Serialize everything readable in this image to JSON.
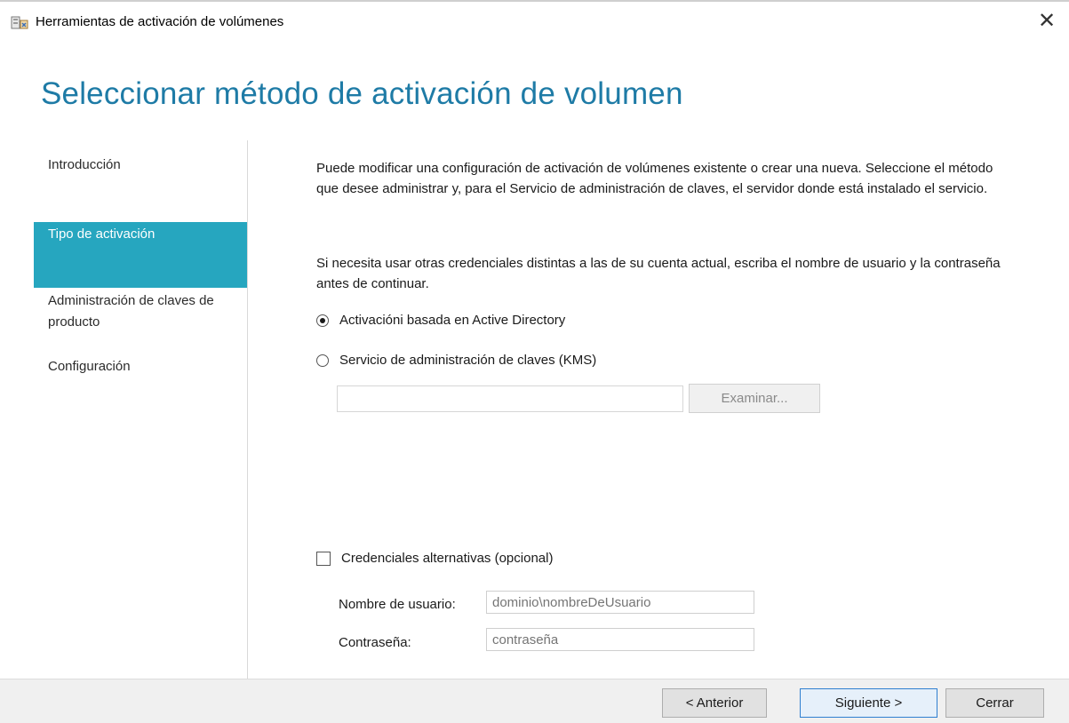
{
  "window": {
    "title": "Herramientas de activación de volúmenes",
    "close_glyph": "✕",
    "app_icon": "volume-activation-tools-icon"
  },
  "page": {
    "title": "Seleccionar método de activación de volumen"
  },
  "nav": {
    "items": [
      {
        "label": "Introducción",
        "active": false
      },
      {
        "label": "Tipo de activación",
        "active": true
      },
      {
        "label": "Administración de claves de producto",
        "active": false
      },
      {
        "label": "Configuración",
        "active": false
      }
    ]
  },
  "content": {
    "para1": "Puede modificar una configuración de activación de volúmenes existente o crear una nueva. Seleccione el método que desee administrar y, para el Servicio de administración de claves, el servidor donde está instalado el servicio.",
    "para2": "Si necesita usar otras credenciales distintas a las de su cuenta actual, escriba el nombre de usuario y la contraseña antes de continuar.",
    "radio_ad": {
      "label": "Activacióni basada en Active Directory",
      "checked": true
    },
    "radio_kms": {
      "label": "Servicio de administración de claves (KMS)",
      "checked": false
    },
    "kms_server_value": "",
    "browse_label": "Examinar...",
    "alt_credentials": {
      "label": "Credenciales alternativas (opcional)",
      "checked": false
    },
    "username": {
      "label": "Nombre de usuario:",
      "placeholder": "dominio\\nombreDeUsuario"
    },
    "password": {
      "label": "Contraseña:",
      "placeholder": "contraseña"
    }
  },
  "footer": {
    "back_label": "< Anterior",
    "next_label": "Siguiente >",
    "close_label": "Cerrar"
  },
  "colors": {
    "accent": "#26a6bf",
    "title": "#1e7ba6"
  }
}
